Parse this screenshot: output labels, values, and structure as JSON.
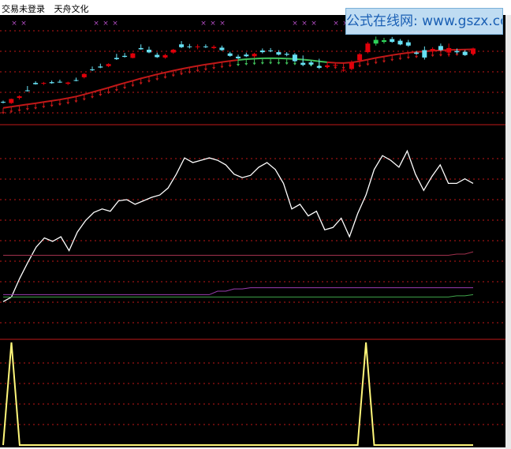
{
  "header": {
    "title_part1": "交易未登录",
    "title_part2": "天舟文化"
  },
  "watermark": {
    "text": "公式在线网: www.gszx.com.cn"
  },
  "colors": {
    "background": "#000000",
    "candle_up": "#e0000a",
    "candle_down": "#67e1f4",
    "candle_green": "#2fd25a",
    "stop_line": "#c01818",
    "oscillator": "#ffffff",
    "upper_band": "#a0304d",
    "mid_band": "#9a3db0",
    "lower_band": "#3fa24a",
    "signal": "#fff77a",
    "grid": "#c01818"
  },
  "chart_data": [
    {
      "type": "candlestick",
      "panel": "price",
      "candles": [
        {
          "o": 4.6,
          "h": 5.2,
          "l": 3.8,
          "c": 4.2
        },
        {
          "o": 4.0,
          "h": 6.2,
          "l": 3.6,
          "c": 6.0
        },
        {
          "o": 6.5,
          "h": 7.8,
          "l": 5.7,
          "c": 7.3
        },
        {
          "o": 10.2,
          "h": 12.3,
          "l": 9.6,
          "c": 9.8
        },
        {
          "o": 13.8,
          "h": 14.6,
          "l": 13.0,
          "c": 13.2
        },
        {
          "o": 13.5,
          "h": 14.3,
          "l": 12.8,
          "c": 13.8
        },
        {
          "o": 14.2,
          "h": 15.0,
          "l": 13.4,
          "c": 13.7
        },
        {
          "o": 14.4,
          "h": 15.4,
          "l": 13.8,
          "c": 14.1
        },
        {
          "o": 13.4,
          "h": 14.4,
          "l": 12.8,
          "c": 14.0
        },
        {
          "o": 15.2,
          "h": 16.4,
          "l": 14.6,
          "c": 14.8
        },
        {
          "o": 16.6,
          "h": 18.6,
          "l": 16.0,
          "c": 18.2
        },
        {
          "o": 20.4,
          "h": 21.8,
          "l": 19.6,
          "c": 20.0
        },
        {
          "o": 21.8,
          "h": 23.2,
          "l": 21.0,
          "c": 21.3
        },
        {
          "o": 22.0,
          "h": 23.4,
          "l": 21.5,
          "c": 23.0
        },
        {
          "o": 26.0,
          "h": 28.0,
          "l": 25.0,
          "c": 25.4
        },
        {
          "o": 27.0,
          "h": 28.4,
          "l": 26.2,
          "c": 26.5
        },
        {
          "o": 26.0,
          "h": 28.5,
          "l": 25.8,
          "c": 28.2
        },
        {
          "o": 30.8,
          "h": 32.6,
          "l": 30.0,
          "c": 30.2
        },
        {
          "o": 30.0,
          "h": 31.5,
          "l": 28.3,
          "c": 28.7
        },
        {
          "o": 27.5,
          "h": 28.6,
          "l": 26.0,
          "c": 26.4
        },
        {
          "o": 26.2,
          "h": 28.0,
          "l": 25.6,
          "c": 27.4
        },
        {
          "o": 28.6,
          "h": 30.4,
          "l": 28.0,
          "c": 30.0
        },
        {
          "o": 32.6,
          "h": 34.2,
          "l": 30.8,
          "c": 31.2
        },
        {
          "o": 31.6,
          "h": 32.8,
          "l": 30.6,
          "c": 31.2
        },
        {
          "o": 31.2,
          "h": 32.6,
          "l": 30.2,
          "c": 31.6
        },
        {
          "o": 31.6,
          "h": 32.6,
          "l": 30.8,
          "c": 31.2
        },
        {
          "o": 30.8,
          "h": 32.2,
          "l": 30.2,
          "c": 31.4
        },
        {
          "o": 31.0,
          "h": 32.0,
          "l": 29.4,
          "c": 29.8
        },
        {
          "o": 28.2,
          "h": 29.0,
          "l": 26.6,
          "c": 27.0
        },
        {
          "o": 26.6,
          "h": 27.6,
          "l": 25.4,
          "c": 25.8
        },
        {
          "o": 27.6,
          "h": 28.6,
          "l": 26.4,
          "c": 26.8
        },
        {
          "o": 26.8,
          "h": 28.5,
          "l": 26.0,
          "c": 28.0
        },
        {
          "o": 29.6,
          "h": 30.6,
          "l": 28.2,
          "c": 28.8
        },
        {
          "o": 29.6,
          "h": 30.8,
          "l": 28.8,
          "c": 29.2
        },
        {
          "o": 28.8,
          "h": 29.8,
          "l": 27.2,
          "c": 27.6
        },
        {
          "o": 28.0,
          "h": 28.8,
          "l": 26.8,
          "c": 27.5
        },
        {
          "o": 27.6,
          "h": 28.4,
          "l": 24.0,
          "c": 24.4
        },
        {
          "o": 23.6,
          "h": 27.2,
          "l": 22.0,
          "c": 22.6
        },
        {
          "o": 23.8,
          "h": 24.6,
          "l": 22.2,
          "c": 22.8
        },
        {
          "o": 22.0,
          "h": 25.6,
          "l": 20.6,
          "c": 21.2
        },
        {
          "o": 21.6,
          "h": 24.0,
          "l": 21.0,
          "c": 22.4
        },
        {
          "o": 22.2,
          "h": 23.2,
          "l": 21.4,
          "c": 22.6
        },
        {
          "o": 19.8,
          "h": 21.0,
          "l": 19.2,
          "c": 20.2
        },
        {
          "o": 20.6,
          "h": 24.8,
          "l": 20.0,
          "c": 24.0
        },
        {
          "o": 24.8,
          "h": 28.4,
          "l": 24.0,
          "c": 27.8
        },
        {
          "o": 28.8,
          "h": 33.8,
          "l": 28.2,
          "c": 33.0
        },
        {
          "o": 33.0,
          "h": 36.4,
          "l": 32.0,
          "c": 34.8
        },
        {
          "o": 33.8,
          "h": 35.8,
          "l": 33.0,
          "c": 34.6
        },
        {
          "o": 35.2,
          "h": 36.2,
          "l": 33.4,
          "c": 33.8
        },
        {
          "o": 34.4,
          "h": 35.2,
          "l": 32.2,
          "c": 32.6
        },
        {
          "o": 33.6,
          "h": 34.8,
          "l": 31.4,
          "c": 32.0
        },
        {
          "o": 28.6,
          "h": 29.4,
          "l": 27.6,
          "c": 28.0
        },
        {
          "o": 29.8,
          "h": 31.6,
          "l": 25.2,
          "c": 26.2
        },
        {
          "o": 29.4,
          "h": 31.2,
          "l": 28.4,
          "c": 30.4
        },
        {
          "o": 31.8,
          "h": 33.0,
          "l": 29.4,
          "c": 29.8
        },
        {
          "o": 28.6,
          "h": 33.0,
          "l": 26.6,
          "c": 30.8
        },
        {
          "o": 29.4,
          "h": 30.6,
          "l": 28.0,
          "c": 28.8
        },
        {
          "o": 29.0,
          "h": 29.8,
          "l": 27.0,
          "c": 27.4
        },
        {
          "o": 28.0,
          "h": 31.0,
          "l": 27.2,
          "c": 30.6
        }
      ],
      "stop_line": [
        1.6,
        2.2,
        2.8,
        3.4,
        3.9,
        4.5,
        5.1,
        5.7,
        6.4,
        7.2,
        8.2,
        9.3,
        10.4,
        11.5,
        12.7,
        13.8,
        14.9,
        16.0,
        17.0,
        18.0,
        18.9,
        19.8,
        20.6,
        21.4,
        22.1,
        22.8,
        23.4,
        24.0,
        24.5,
        25.0,
        25.4,
        25.6,
        25.8,
        25.9,
        25.8,
        25.7,
        25.5,
        25.2,
        24.8,
        24.3,
        23.9,
        23.6,
        23.5,
        23.8,
        24.4,
        25.2,
        26.0,
        26.7,
        27.4,
        28.0,
        28.5,
        28.9,
        29.2,
        29.5,
        29.7,
        29.9,
        30.0,
        30.1,
        30.2
      ],
      "stop_line_color_segments": [
        {
          "from": 0,
          "to": 29,
          "color": "#c01818"
        },
        {
          "from": 29,
          "to": 40,
          "color": "#3fbf5a"
        },
        {
          "from": 40,
          "to": 58,
          "color": "#c01818"
        }
      ],
      "ylim": [
        0,
        40
      ]
    },
    {
      "type": "line",
      "panel": "oscillator",
      "series": [
        {
          "values": [
            8,
            12,
            28,
            42,
            55,
            63,
            60,
            64,
            52,
            68,
            78,
            85,
            88,
            86,
            95,
            96,
            92,
            95,
            98,
            100,
            106,
            118,
            132,
            128,
            130,
            132,
            130,
            126,
            118,
            115,
            117,
            124,
            128,
            122,
            110,
            88,
            92,
            82,
            86,
            70,
            72,
            80,
            64,
            84,
            100,
            122,
            134,
            130,
            124,
            138,
            118,
            104,
            116,
            126,
            110,
            110,
            114,
            110
          ],
          "color": "#ffffff"
        },
        {
          "values": [
            48,
            48,
            48,
            48,
            48,
            48,
            48,
            48,
            48,
            48,
            48,
            48,
            48,
            48,
            48,
            48,
            48,
            48,
            48,
            48,
            48,
            48,
            48,
            48,
            48,
            48,
            48,
            48,
            48,
            48,
            48,
            48,
            48,
            48,
            48,
            48,
            48,
            48,
            48,
            48,
            48,
            48,
            48,
            48,
            48,
            48,
            48,
            48,
            48,
            48,
            48,
            48,
            48,
            48,
            48,
            49,
            49,
            51
          ],
          "color": "#a0304d"
        },
        {
          "values": [
            14,
            14,
            14,
            14,
            14,
            14,
            14,
            14,
            14,
            14,
            14,
            14,
            14,
            14,
            14,
            14,
            14,
            14,
            14,
            14,
            14,
            14,
            14,
            14,
            14,
            14,
            17,
            17,
            19,
            19,
            20,
            20,
            20,
            20,
            20,
            20,
            20,
            20,
            20,
            20,
            20,
            20,
            20,
            20,
            20,
            20,
            20,
            20,
            20,
            20,
            20,
            20,
            20,
            20,
            20,
            20,
            20,
            20
          ],
          "color": "#9a3db0"
        },
        {
          "values": [
            12,
            12,
            12,
            12,
            12,
            12,
            12,
            12,
            12,
            12,
            12,
            12,
            12,
            12,
            12,
            12,
            12,
            12,
            12,
            12,
            12,
            12,
            12,
            12,
            12,
            12,
            12,
            12,
            12,
            12,
            12,
            12,
            12,
            12,
            12,
            12,
            12,
            12,
            12,
            12,
            12,
            12,
            12,
            12,
            12,
            12,
            12,
            12,
            12,
            12,
            12,
            12,
            12,
            12,
            12,
            13,
            13,
            14
          ],
          "color": "#3fa24a"
        }
      ],
      "ylim": [
        0,
        160
      ]
    },
    {
      "type": "line",
      "panel": "signal",
      "series": [
        {
          "values": [
            0,
            1,
            0,
            0,
            0,
            0,
            0,
            0,
            0,
            0,
            0,
            0,
            0,
            0,
            0,
            0,
            0,
            0,
            0,
            0,
            0,
            0,
            0,
            0,
            0,
            0,
            0,
            0,
            0,
            0,
            0,
            0,
            0,
            0,
            0,
            0,
            0,
            0,
            0,
            0,
            0,
            0,
            0,
            0,
            1,
            0,
            0,
            0,
            0,
            0,
            0,
            0,
            0,
            0,
            0,
            0,
            0,
            0
          ],
          "color": "#fff77a"
        }
      ],
      "ylim": [
        0,
        1
      ]
    }
  ]
}
